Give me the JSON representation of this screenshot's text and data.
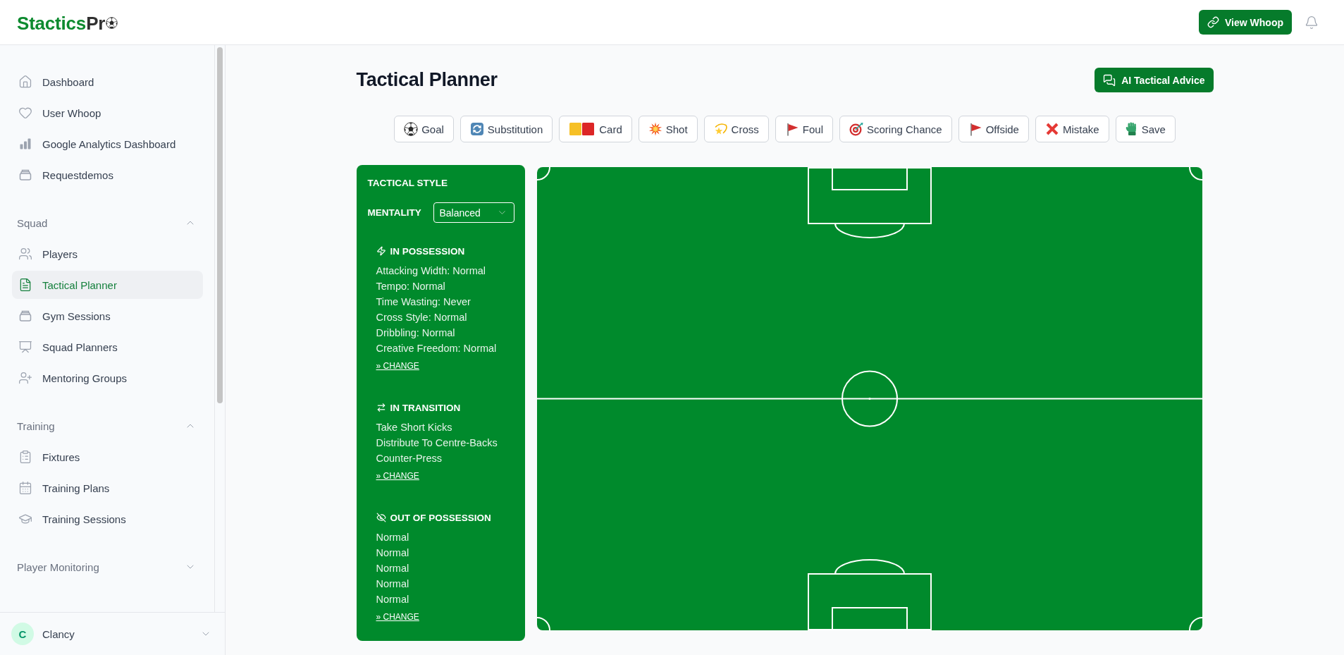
{
  "header": {
    "brand": {
      "primary": "Stactics",
      "secondary": "Pr"
    },
    "view_button": "View Whoop"
  },
  "sidebar": {
    "links": [
      {
        "kind": "home",
        "label": "Dashboard",
        "selected": false
      },
      {
        "kind": "heart",
        "label": "User Whoop",
        "selected": false
      },
      {
        "kind": "chart",
        "label": "Google Analytics Dashboard",
        "selected": false
      },
      {
        "kind": "tray",
        "label": "Requestdemos",
        "selected": false
      }
    ],
    "sections": [
      {
        "title": "Squad",
        "expanded": true,
        "items": [
          {
            "kind": "users",
            "label": "Players",
            "selected": false
          },
          {
            "kind": "document",
            "label": "Tactical Planner",
            "selected": true
          },
          {
            "kind": "tray",
            "label": "Gym Sessions",
            "selected": false
          },
          {
            "kind": "presentation",
            "label": "Squad Planners",
            "selected": false
          },
          {
            "kind": "adduser",
            "label": "Mentoring Groups",
            "selected": false
          }
        ]
      },
      {
        "title": "Training",
        "expanded": true,
        "items": [
          {
            "kind": "clipboard",
            "label": "Fixtures",
            "selected": false
          },
          {
            "kind": "calendar",
            "label": "Training Plans",
            "selected": false
          },
          {
            "kind": "cap",
            "label": "Training Sessions",
            "selected": false
          }
        ]
      },
      {
        "title": "Player Monitoring",
        "expanded": false
      }
    ],
    "user": {
      "initial": "C",
      "name": "Clancy"
    }
  },
  "page": {
    "title": "Tactical Planner",
    "advice_button": "AI Tactical Advice"
  },
  "event_buttons": [
    {
      "kind": "goal",
      "label": "Goal"
    },
    {
      "kind": "substitution",
      "label": "Substitution"
    },
    {
      "kind": "card",
      "label": "Card"
    },
    {
      "kind": "shot",
      "label": "Shot"
    },
    {
      "kind": "cross",
      "label": "Cross"
    },
    {
      "kind": "foul",
      "label": "Foul"
    },
    {
      "kind": "chance",
      "label": "Scoring Chance"
    },
    {
      "kind": "offside",
      "label": "Offside"
    },
    {
      "kind": "mistake",
      "label": "Mistake"
    },
    {
      "kind": "save",
      "label": "Save"
    }
  ],
  "tactical_style": {
    "title": "TACTICAL STYLE",
    "mentality": {
      "label": "MENTALITY",
      "value": "Balanced"
    },
    "sections": [
      {
        "kind": "attack",
        "title": "IN POSSESSION",
        "lines": [
          "Attacking Width: Normal",
          "Tempo: Normal",
          "Time Wasting: Never",
          "Cross Style: Normal",
          "Dribbling: Normal",
          "Creative Freedom: Normal"
        ],
        "link": "» CHANGE"
      },
      {
        "kind": "transition",
        "title": "IN TRANSITION",
        "lines": [
          "Take Short Kicks",
          "Distribute To Centre-Backs",
          "Counter-Press"
        ],
        "link": "» CHANGE"
      },
      {
        "kind": "defence",
        "title": "OUT OF POSSESSION",
        "lines": [
          "Normal",
          "Normal",
          "Normal",
          "Normal",
          "Normal"
        ],
        "link": "» CHANGE"
      }
    ]
  }
}
